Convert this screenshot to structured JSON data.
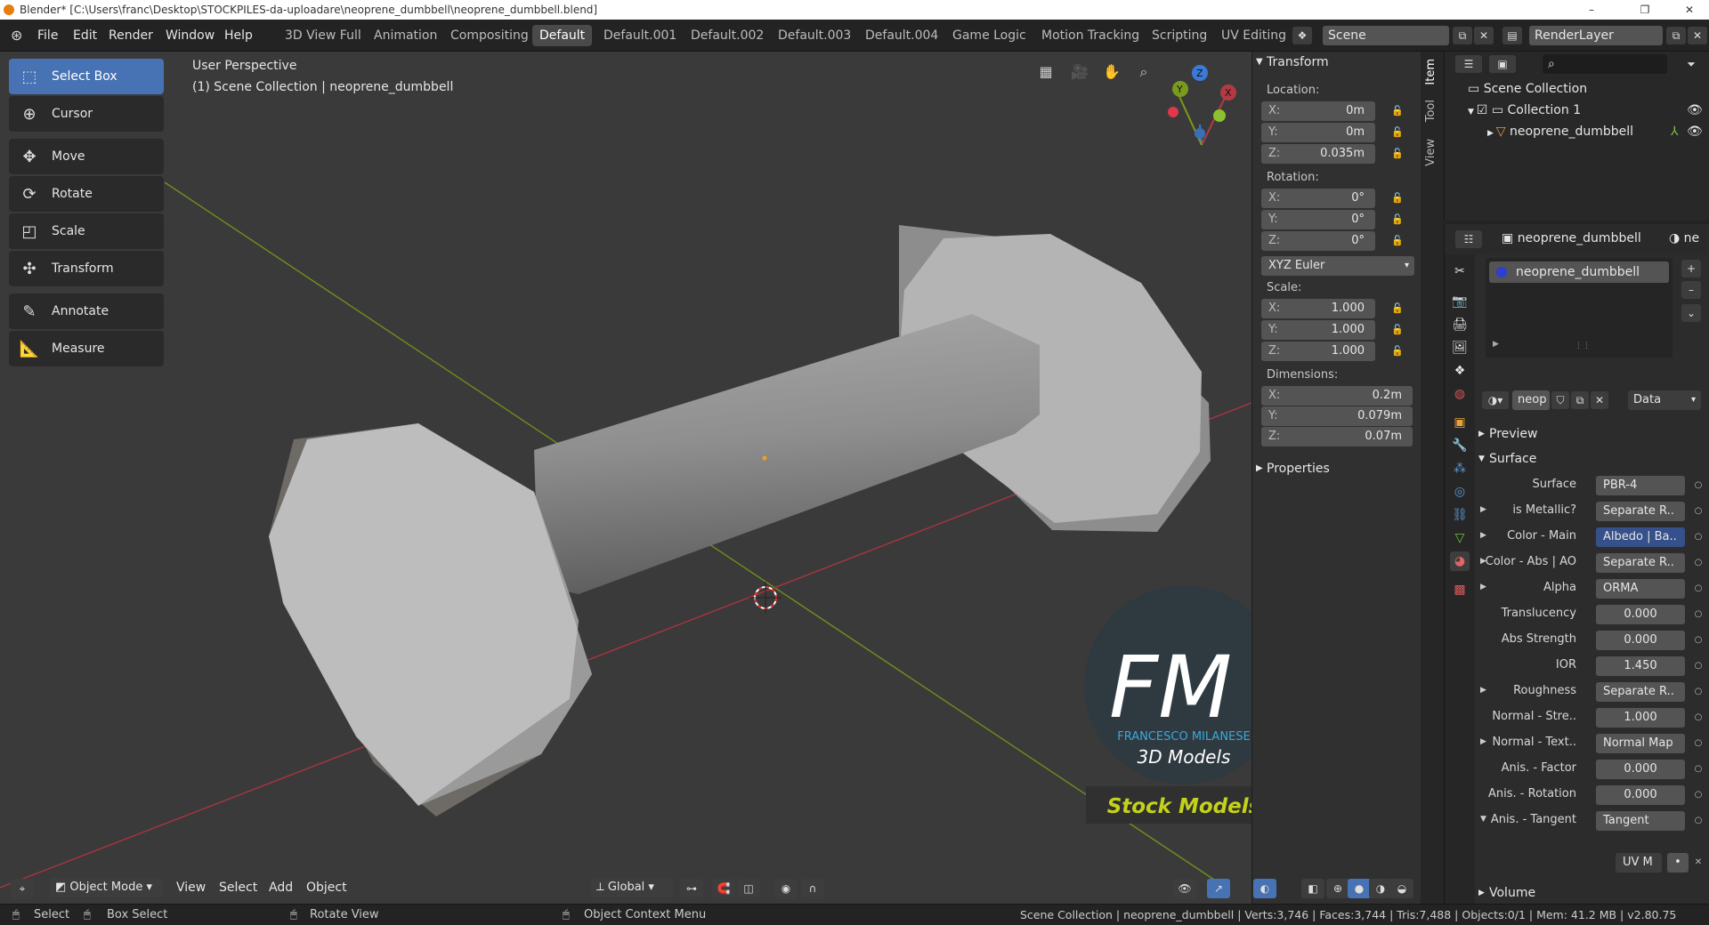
{
  "window": {
    "title": "Blender* [C:\\Users\\franc\\Desktop\\STOCKPILES-da-uploadare\\neoprene_dumbbell\\neoprene_dumbbell.blend]"
  },
  "menu": [
    "File",
    "Edit",
    "Render",
    "Window",
    "Help"
  ],
  "workspaces": [
    "3D View Full",
    "Animation",
    "Compositing",
    "Default",
    "Default.001",
    "Default.002",
    "Default.003",
    "Default.004",
    "Game Logic",
    "Motion Tracking",
    "Scripting",
    "UV Editing"
  ],
  "scene": "Scene",
  "render_layer": "RenderLayer",
  "tools": [
    "Select Box",
    "Cursor",
    "Move",
    "Rotate",
    "Scale",
    "Transform",
    "Annotate",
    "Measure"
  ],
  "viewport": {
    "perspective": "User Perspective",
    "collection": "(1) Scene Collection | neoprene_dumbbell"
  },
  "gizmo": {
    "x": "X",
    "y": "Y",
    "z": "Z"
  },
  "npanel": {
    "tabs": [
      "Item",
      "Tool",
      "View"
    ],
    "transform_title": "Transform",
    "location_label": "Location:",
    "location": [
      {
        "k": "X:",
        "v": "0m"
      },
      {
        "k": "Y:",
        "v": "0m"
      },
      {
        "k": "Z:",
        "v": "0.035m"
      }
    ],
    "rotation_label": "Rotation:",
    "rotation": [
      {
        "k": "X:",
        "v": "0°"
      },
      {
        "k": "Y:",
        "v": "0°"
      },
      {
        "k": "Z:",
        "v": "0°"
      }
    ],
    "rotation_mode": "XYZ Euler",
    "scale_label": "Scale:",
    "scale": [
      {
        "k": "X:",
        "v": "1.000"
      },
      {
        "k": "Y:",
        "v": "1.000"
      },
      {
        "k": "Z:",
        "v": "1.000"
      }
    ],
    "dimensions_label": "Dimensions:",
    "dimensions": [
      {
        "k": "X:",
        "v": "0.2m"
      },
      {
        "k": "Y:",
        "v": "0.079m"
      },
      {
        "k": "Z:",
        "v": "0.07m"
      }
    ],
    "properties_title": "Properties"
  },
  "outliner": {
    "root": "Scene Collection",
    "collection": "Collection 1",
    "object": "neoprene_dumbbell"
  },
  "props": {
    "object_name": "neoprene_dumbbell",
    "object_name_short": "ne",
    "material_slot": "neoprene_dumbbell",
    "material_short": "neop",
    "data_select": "Data",
    "preview": "Preview",
    "surface_title": "Surface",
    "rows": [
      {
        "label": "Surface",
        "value": "PBR-4",
        "type": "text",
        "tri": false
      },
      {
        "label": "is Metallic?",
        "value": "Separate R..",
        "type": "text",
        "tri": true
      },
      {
        "label": "Color - Main",
        "value": "Albedo | Ba..",
        "type": "blue",
        "tri": true
      },
      {
        "label": "Color - Abs | AO",
        "value": "Separate R..",
        "type": "text",
        "tri": true
      },
      {
        "label": "Alpha",
        "value": "ORMA",
        "type": "text",
        "tri": true
      },
      {
        "label": "Translucency",
        "value": "0.000",
        "type": "num",
        "tri": false
      },
      {
        "label": "Abs Strength",
        "value": "0.000",
        "type": "num",
        "tri": false
      },
      {
        "label": "IOR",
        "value": "1.450",
        "type": "num",
        "tri": false
      },
      {
        "label": "Roughness",
        "value": "Separate R..",
        "type": "text",
        "tri": true
      },
      {
        "label": "Normal - Stre..",
        "value": "1.000",
        "type": "num",
        "tri": false
      },
      {
        "label": "Normal - Text..",
        "value": "Normal Map",
        "type": "text",
        "tri": true
      },
      {
        "label": "Anis. - Factor",
        "value": "0.000",
        "type": "num",
        "tri": false
      },
      {
        "label": "Anis. - Rotation",
        "value": "0.000",
        "type": "num",
        "tri": false
      },
      {
        "label": "Anis. - Tangent",
        "value": "Tangent",
        "type": "text",
        "tri": true
      }
    ],
    "uvmap": "UV M",
    "volume": "Volume"
  },
  "vpheader": {
    "mode": "Object Mode",
    "menus": [
      "View",
      "Select",
      "Add",
      "Object"
    ],
    "orientation": "Global"
  },
  "statusbar": {
    "select": "Select",
    "box_select": "Box Select",
    "rotate_view": "Rotate View",
    "context": "Object Context Menu",
    "info": "Scene Collection | neoprene_dumbbell | Verts:3,746 | Faces:3,744 | Tris:7,488 | Objects:0/1 | Mem: 41.2 MB | v2.80.75"
  },
  "logo": {
    "letters": "FM",
    "name": "FRANCESCO MILANESE",
    "tag": "3D Models",
    "banner": "Stock Models"
  },
  "colors": {
    "accent": "#4772b3",
    "viewport_bg": "#3a3a3a",
    "x_axis": "#b33a45",
    "y_axis": "#7a9a1e",
    "z_axis": "#3b7ad8"
  }
}
